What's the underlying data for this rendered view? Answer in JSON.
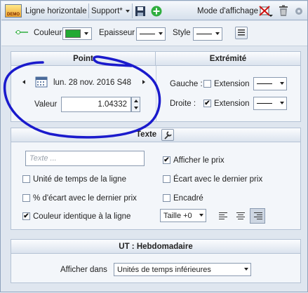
{
  "toolbar": {
    "demo_badge": "DEMO",
    "title": "Ligne horizontale",
    "support_label": "Support*",
    "mode_label": "Mode d'affichage"
  },
  "style_row": {
    "color_label": "Couleur",
    "color_value": "#22aa33",
    "thickness_label": "Epaisseur",
    "style_label": "Style"
  },
  "point": {
    "header": "Point",
    "date": "lun. 28 nov. 2016 S48",
    "value_label": "Valeur",
    "value": "1.04332"
  },
  "extremity": {
    "header": "Extrémité",
    "left_label": "Gauche :",
    "left_extension_label": "Extension",
    "left_checked": false,
    "right_label": "Droite :",
    "right_extension_label": "Extension",
    "right_checked": true
  },
  "texte": {
    "header": "Texte",
    "placeholder": "Texte ...",
    "show_price": "Afficher le prix",
    "show_price_checked": true,
    "unit_time": "Unité de temps de la ligne",
    "unit_time_checked": false,
    "gap_last_price": "Écart avec le dernier prix",
    "gap_last_price_checked": false,
    "pct_gap": "% d'écart avec le dernier prix",
    "pct_gap_checked": false,
    "framed": "Encadré",
    "framed_checked": false,
    "same_color": "Couleur identique à la ligne",
    "same_color_checked": true,
    "size_value": "Taille +0"
  },
  "ut": {
    "header": "UT : Hebdomadaire",
    "display_in_label": "Afficher dans",
    "display_in_value": "Unités de temps inférieures"
  },
  "colors": {
    "annotation": "#1a1acc"
  }
}
